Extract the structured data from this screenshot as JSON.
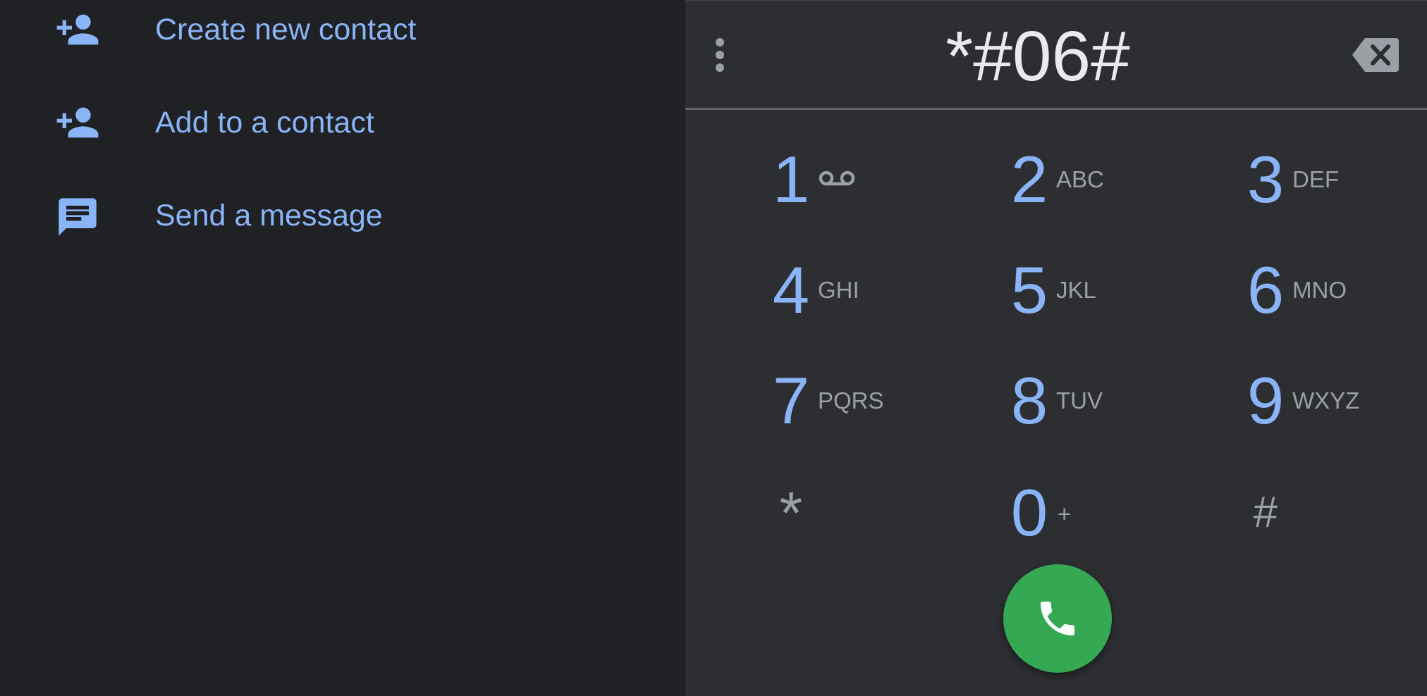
{
  "actions": [
    {
      "label": "Create new contact",
      "icon": "person-add-icon"
    },
    {
      "label": "Add to a contact",
      "icon": "person-add-icon"
    },
    {
      "label": "Send a message",
      "icon": "message-icon"
    }
  ],
  "dialer": {
    "number": "*#06#",
    "menu_icon": "more-vert-icon",
    "backspace_icon": "backspace-icon",
    "keys": [
      {
        "digit": "1",
        "letters": "",
        "icon": "voicemail-icon"
      },
      {
        "digit": "2",
        "letters": "ABC"
      },
      {
        "digit": "3",
        "letters": "DEF"
      },
      {
        "digit": "4",
        "letters": "GHI"
      },
      {
        "digit": "5",
        "letters": "JKL"
      },
      {
        "digit": "6",
        "letters": "MNO"
      },
      {
        "digit": "7",
        "letters": "PQRS"
      },
      {
        "digit": "8",
        "letters": "TUV"
      },
      {
        "digit": "9",
        "letters": "WXYZ"
      },
      {
        "digit": "*",
        "letters": ""
      },
      {
        "digit": "0",
        "letters": "+"
      },
      {
        "digit": "#",
        "letters": ""
      }
    ],
    "call_icon": "phone-icon"
  },
  "colors": {
    "background": "#202124",
    "dialer_background": "#2d2e31",
    "accent": "#8ab4f8",
    "secondary_text": "#9aa0a6",
    "call_button": "#34a853"
  }
}
